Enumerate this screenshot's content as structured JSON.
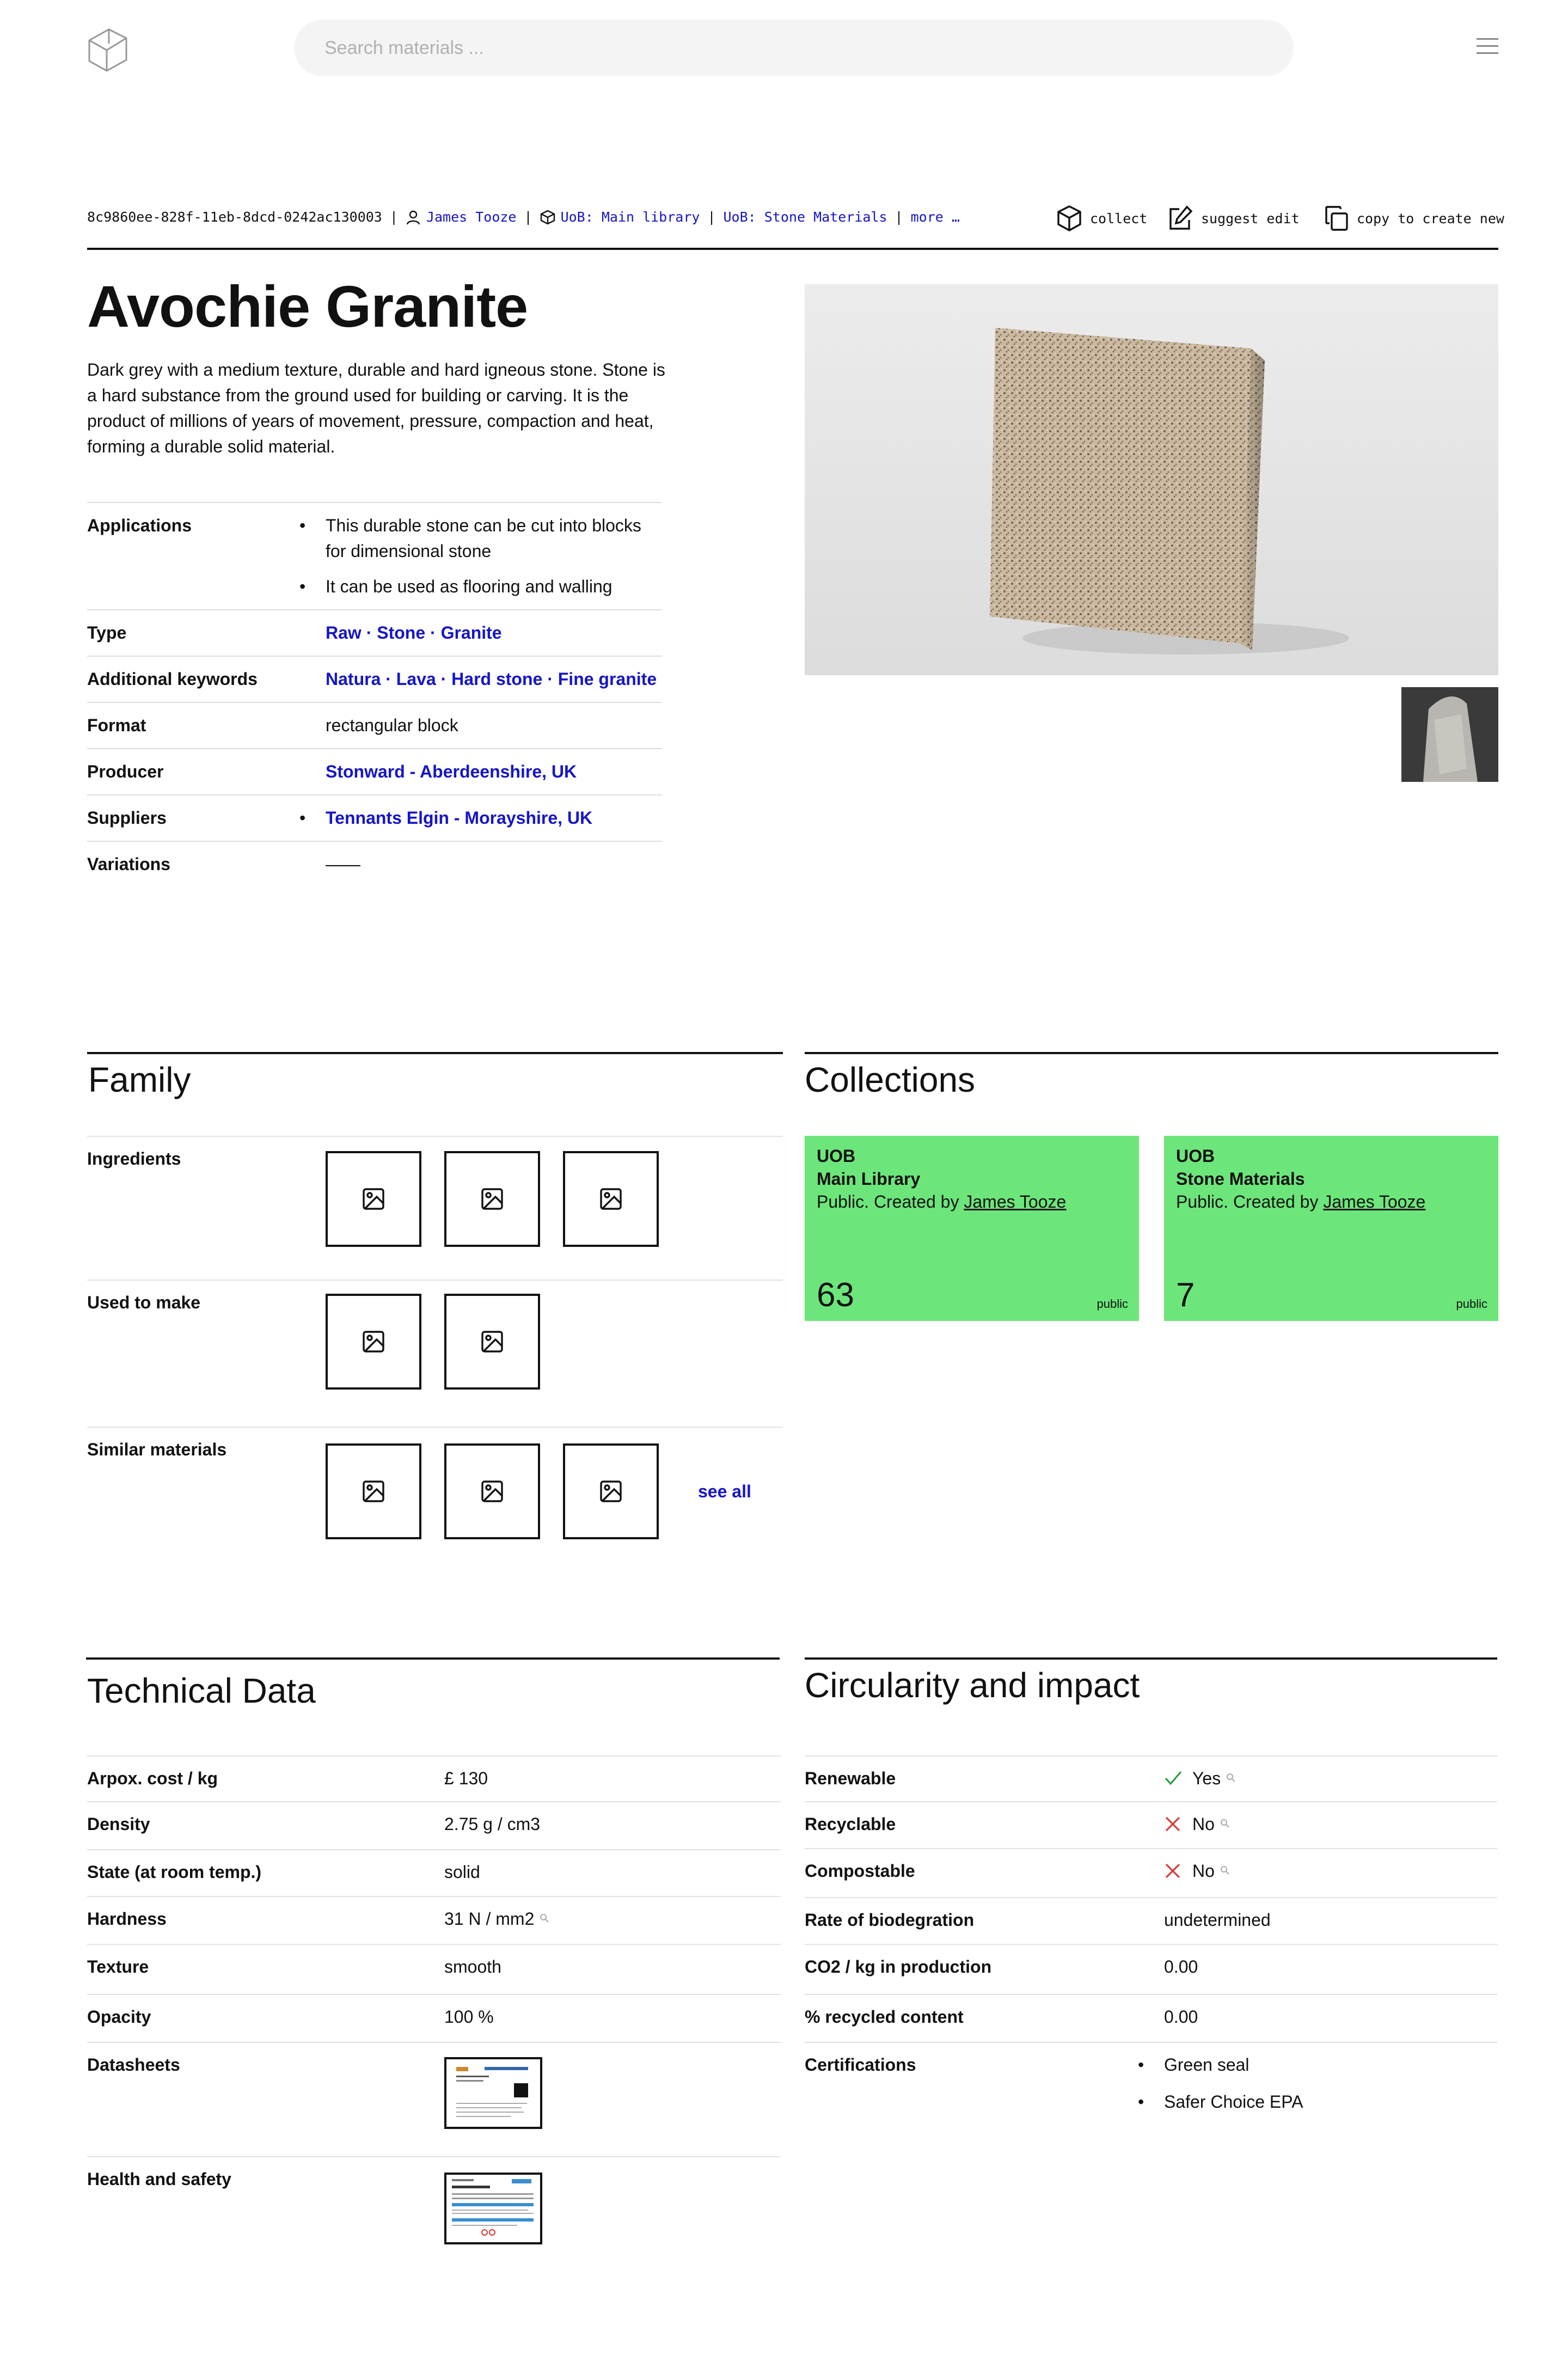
{
  "search": {
    "placeholder": "Search materials ..."
  },
  "meta": {
    "id": "8c9860ee-828f-11eb-8dcd-0242ac130003",
    "author": "James Tooze",
    "collections": [
      "UoB: Main library",
      "UoB: Stone Materials"
    ],
    "more": "more …",
    "separator": "|"
  },
  "actions": {
    "collect": "collect",
    "suggest_edit": "suggest edit",
    "copy": "copy to create new"
  },
  "material": {
    "title": "Avochie Granite",
    "description": "Dark grey with a medium texture, durable and hard igneous stone. Stone is a hard substance from the ground used for building or carving. It is the product of millions of years of movement, pressure, compaction and heat, forming a durable solid material."
  },
  "properties": {
    "applications_label": "Applications",
    "applications": [
      "This durable stone can be cut into blocks for dimensional stone",
      "It can be used as flooring and walling"
    ],
    "type_label": "Type",
    "type": "Raw · Stone · Granite",
    "keywords_label": "Additional keywords",
    "keywords": "Natura · Lava · Hard stone · Fine granite",
    "format_label": "Format",
    "format": "rectangular block",
    "producer_label": "Producer",
    "producer": "Stonward - Aberdeenshire, UK",
    "suppliers_label": "Suppliers",
    "suppliers": [
      "Tennants Elgin - Morayshire, UK"
    ],
    "variations_label": "Variations",
    "variations": "——"
  },
  "family": {
    "heading": "Family",
    "ingredients_label": "Ingredients",
    "used_to_make_label": "Used to make",
    "similar_label": "Similar materials",
    "see_all": "see all"
  },
  "collections_section": {
    "heading": "Collections",
    "items": [
      {
        "org": "UOB",
        "name": "Main Library",
        "by_prefix": "Public. Created by",
        "creator": "James Tooze",
        "count": "63",
        "visibility": "public",
        "color": "#6ce67a"
      },
      {
        "org": "UOB",
        "name": "Stone Materials",
        "by_prefix": "Public. Created by",
        "creator": "James Tooze",
        "count": "7",
        "visibility": "public",
        "color": "#6ce67a"
      }
    ]
  },
  "technical": {
    "heading": "Technical Data",
    "rows": [
      {
        "label": "Arpox. cost / kg",
        "value": "£ 130"
      },
      {
        "label": "Density",
        "value": "2.75 g / cm3"
      },
      {
        "label": "State (at room temp.)",
        "value": "solid"
      },
      {
        "label": "Hardness",
        "value": "31 N / mm2"
      },
      {
        "label": "Texture",
        "value": "smooth"
      },
      {
        "label": "Opacity",
        "value": "100 %"
      }
    ],
    "datasheets_label": "Datasheets",
    "health_label": "Health and safety"
  },
  "circularity": {
    "heading": "Circularity and impact",
    "rows": [
      {
        "label": "Renewable",
        "value": "Yes",
        "icon": "check-icon"
      },
      {
        "label": "Recyclable",
        "value": "No",
        "icon": "cross-icon"
      },
      {
        "label": "Compostable",
        "value": "No",
        "icon": "cross-icon"
      },
      {
        "label": "Rate of biodegration",
        "value": "undetermined"
      },
      {
        "label": "CO2 / kg in production",
        "value": "0.00"
      },
      {
        "label": "% recycled content",
        "value": "0.00"
      }
    ],
    "certifications_label": "Certifications",
    "certifications": [
      "Green seal",
      "Safer Choice EPA"
    ]
  },
  "colors": {
    "link": "#1515c8",
    "collection_card": "#6ce67a",
    "check": "#2e9e3a",
    "cross": "#d43c3c"
  }
}
